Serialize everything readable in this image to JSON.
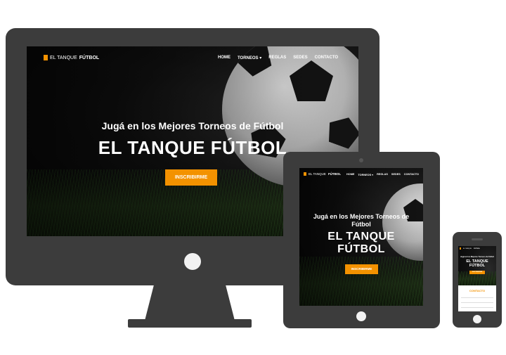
{
  "site": {
    "logo_light": "EL TANQUE",
    "logo_bold": "FÚTBOL",
    "nav": [
      {
        "label": "HOME"
      },
      {
        "label": "TORNEOS ▾"
      },
      {
        "label": "REGLAS"
      },
      {
        "label": "SEDES"
      },
      {
        "label": "CONTACTO"
      }
    ],
    "hero_subtitle": "Jugá en los Mejores Torneos de Fútbol",
    "hero_title": "EL TANQUE FÚTBOL",
    "hero_title_line1": "EL TANQUE",
    "hero_title_line2": "FÚTBOL",
    "cta_label": "INSCRIBIRME",
    "contact_title": "CONTACTO"
  },
  "colors": {
    "accent": "#f39200",
    "device_frame": "#3c3c3c",
    "background": "#ffffff"
  }
}
